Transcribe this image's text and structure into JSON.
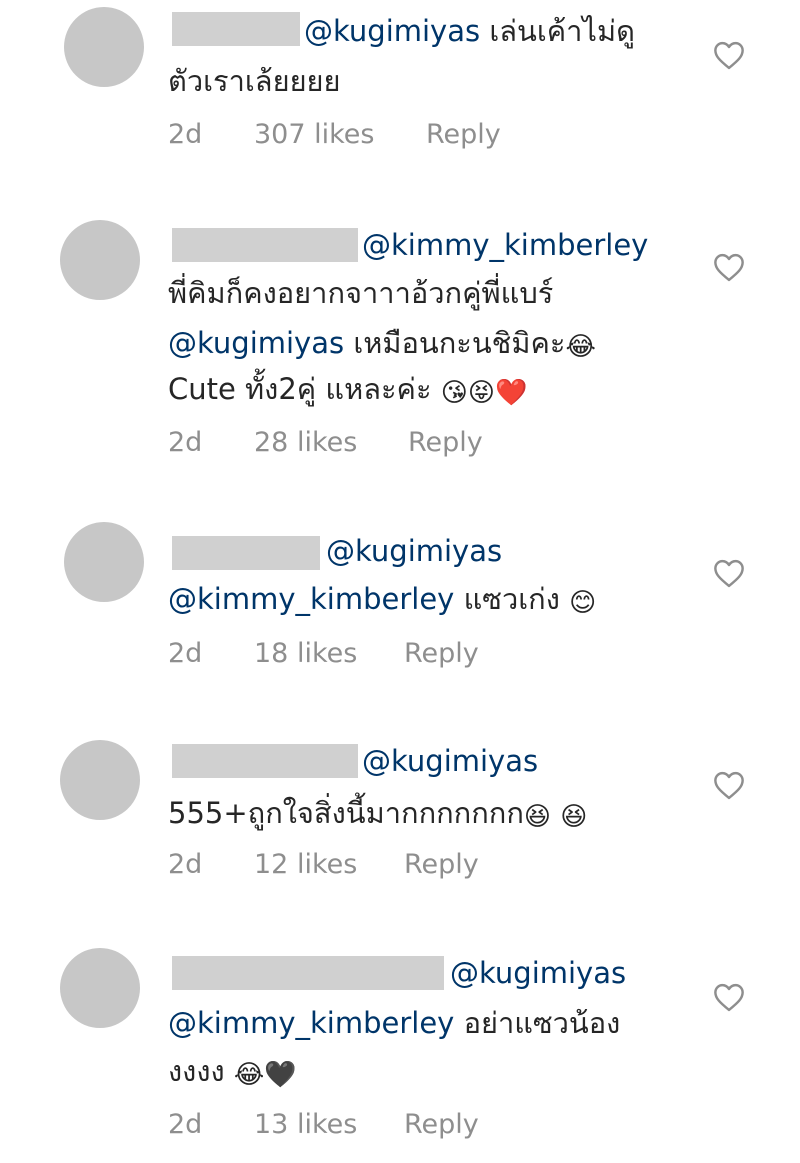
{
  "comments": [
    {
      "mention": "@kugimiyas",
      "text_line1": "เล่นเค้าไม่ดู",
      "text_line2": "ตัวเราเล้ยยยย",
      "time": "2d",
      "likes": "307 likes",
      "reply": "Reply"
    },
    {
      "mention": "@kimmy_kimberley",
      "text_line1": "พี่คิมก็คงอยากจาาาอ้วกคู่พี่แบร์",
      "line2_mention": "@kugimiyas",
      "line2_text": "เหมือนกะนชิมิคะ",
      "line3_text": "Cute ทั้ง2คู่ แหละค่ะ",
      "time": "2d",
      "likes": "28 likes",
      "reply": "Reply"
    },
    {
      "mention": "@kugimiyas",
      "line2_mention": "@kimmy_kimberley",
      "line2_text": "แซวเก่ง",
      "time": "2d",
      "likes": "18 likes",
      "reply": "Reply"
    },
    {
      "mention": "@kugimiyas",
      "text_line1": "555+ถูกใจสิ่งนี้มากกกกกกก",
      "time": "2d",
      "likes": "12 likes",
      "reply": "Reply"
    },
    {
      "mention": "@kugimiyas",
      "line2_mention": "@kimmy_kimberley",
      "line2_text": "อย่าแซวน้อง",
      "line3_text": "งงงง",
      "time": "2d",
      "likes": "13 likes",
      "reply": "Reply"
    }
  ],
  "icons": {
    "like": "heart-outline-icon",
    "laugh": "face-with-tears-of-joy",
    "kiss": "face-blowing-kiss",
    "tongue": "squinting-face-with-tongue",
    "heart_red": "red-heart",
    "smile": "smiling-face-with-smiling-eyes",
    "grin": "grinning-squinting-face",
    "black_heart": "black-heart"
  },
  "colors": {
    "mention": "#003569",
    "meta": "#8e8e8e",
    "avatar": "#c7c7c7",
    "redaction": "#d0d0d0"
  }
}
